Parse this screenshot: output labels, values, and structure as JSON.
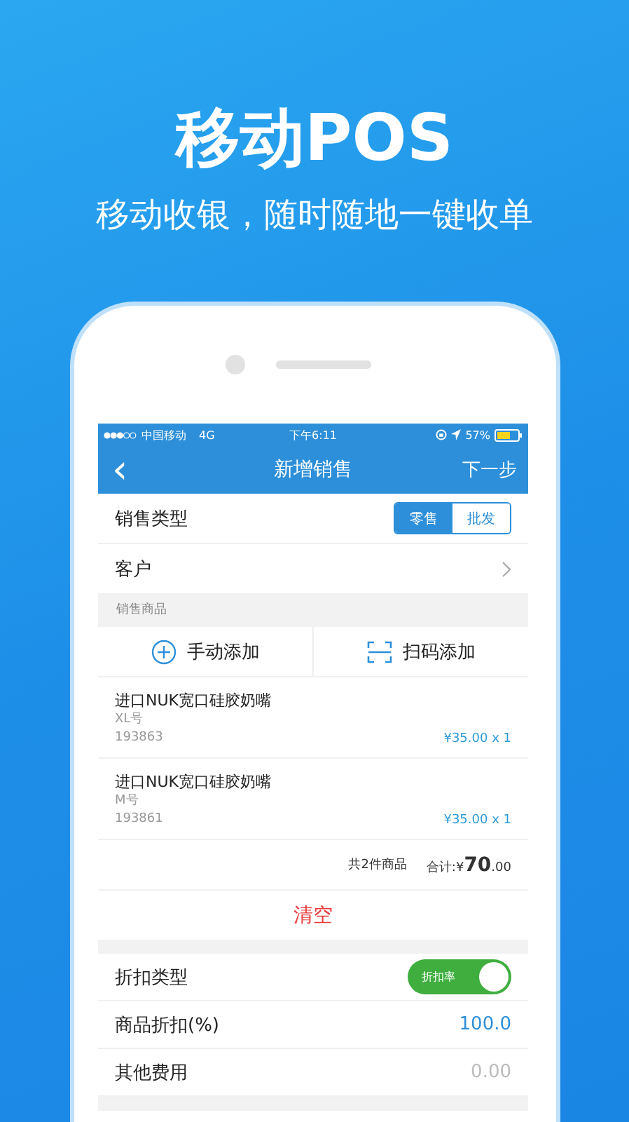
{
  "hero": {
    "title": "移动POS",
    "subtitle": "移动收银，随时随地一键收单"
  },
  "status_bar": {
    "carrier": "中国移动",
    "network": "4G",
    "time": "下午6:11",
    "battery": "57%"
  },
  "nav": {
    "back": "‹",
    "title": "新增销售",
    "next": "下一步"
  },
  "sale_type": {
    "label": "销售类型",
    "options": [
      {
        "label": "零售",
        "selected": true
      },
      {
        "label": "批发",
        "selected": false
      }
    ]
  },
  "customer": {
    "label": "客户"
  },
  "goods_section": {
    "title": "销售商品",
    "actions": [
      {
        "kind": "manual",
        "label": "手动添加"
      },
      {
        "kind": "scan",
        "label": "扫码添加"
      }
    ]
  },
  "items": [
    {
      "name": "进口NUK宽口硅胶奶嘴",
      "spec": "XL号",
      "code": "193863",
      "price": "¥35.00 x 1"
    },
    {
      "name": "进口NUK宽口硅胶奶嘴",
      "spec": "M号",
      "code": "193861",
      "price": "¥35.00 x 1"
    }
  ],
  "summary": {
    "count": "共2件商品",
    "total": "合计:¥**70**.00"
  },
  "clear_button": "清空",
  "discount": [
    {
      "kind": "switch",
      "label": "折扣类型",
      "switch_label": "折扣率",
      "on": true
    },
    {
      "kind": "value",
      "label": "商品折扣(%)",
      "value": "100.0"
    },
    {
      "kind": "placeholder",
      "label": "其他费用",
      "placeholder": "0.00"
    }
  ]
}
